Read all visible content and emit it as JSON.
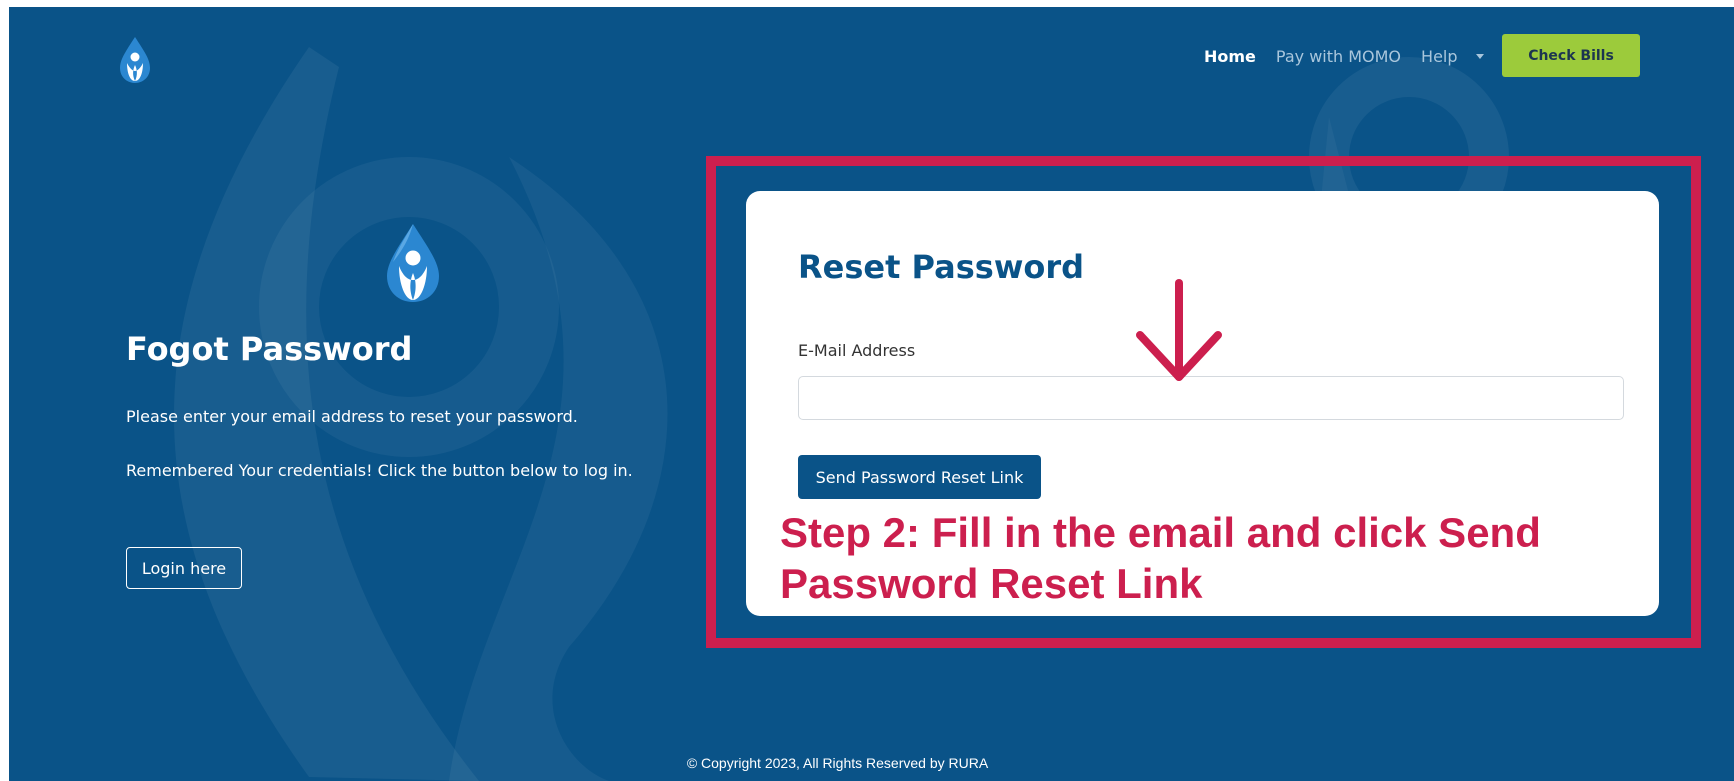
{
  "brand": {
    "logo_icon": "water-drop-person-icon"
  },
  "nav": {
    "items": [
      {
        "label": "Home",
        "active": true
      },
      {
        "label": "Pay with MOMO",
        "active": false
      },
      {
        "label": "Help",
        "active": false
      }
    ],
    "dropdown_icon": "caret-down-icon",
    "cta_label": "Check Bills"
  },
  "left": {
    "title": "Fogot Password",
    "instruction": "Please enter your email address to reset your password.",
    "remember_text": "Remembered Your credentials! Click the button below to log in.",
    "login_label": "Login here"
  },
  "form": {
    "title": "Reset Password",
    "email_label": "E-Mail Address",
    "email_value": "",
    "submit_label": "Send Password Reset Link"
  },
  "annotation": {
    "text": "Step 2: Fill in the email and click Send Password Reset Link",
    "arrow_icon": "arrow-down-icon"
  },
  "footer": {
    "copyright": "© Copyright 2023, All Rights Reserved by RURA"
  },
  "colors": {
    "background": "#0a5388",
    "cta": "#9ccb3b",
    "annotation": "#cc1f4e",
    "title": "#0a5388"
  }
}
